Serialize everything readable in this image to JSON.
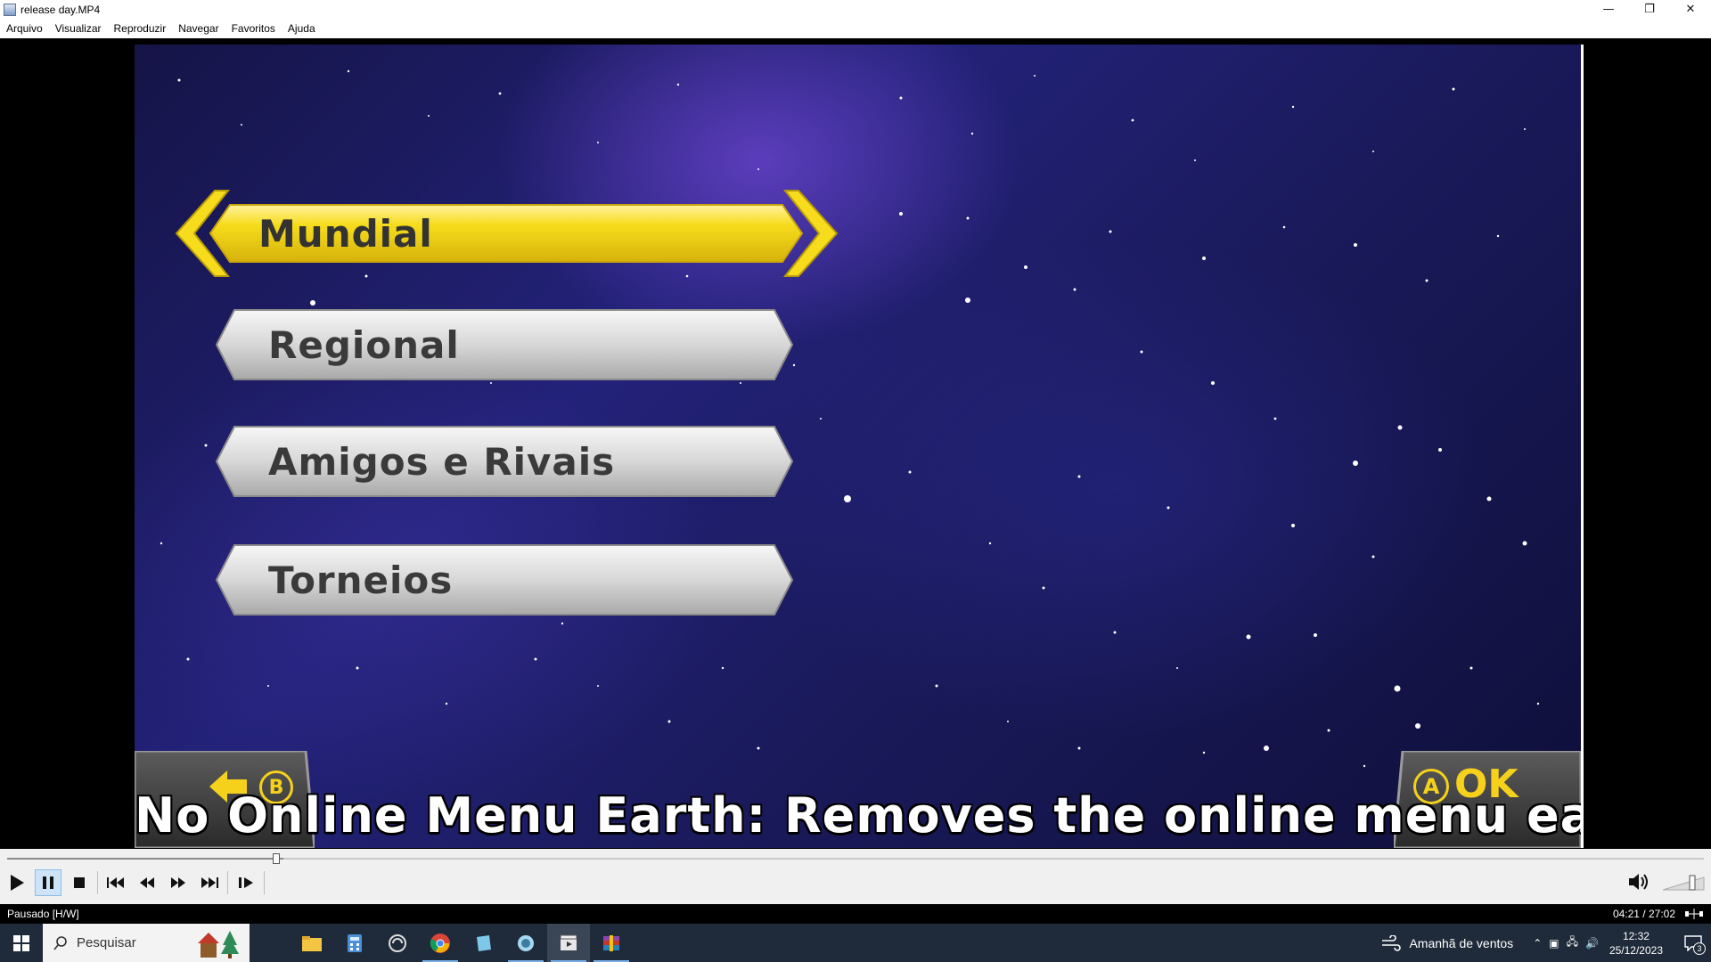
{
  "window": {
    "title": "release day.MP4",
    "controls": {
      "minimize": "—",
      "restore": "❐",
      "close": "✕"
    }
  },
  "menubar": {
    "items": [
      "Arquivo",
      "Visualizar",
      "Reproduzir",
      "Navegar",
      "Favoritos",
      "Ajuda"
    ]
  },
  "video": {
    "menu_options": [
      "Mundial",
      "Regional",
      "Amigos e Rivais",
      "Torneios"
    ],
    "selected_option": "Mundial",
    "back_button_glyph": "B",
    "ok_button_glyph": "A",
    "ok_label": "OK",
    "caption": "No Online Menu Earth: Removes the online menu earth"
  },
  "player": {
    "seek_progress_fraction": 0.163,
    "state": "paused",
    "controls": [
      "play-icon",
      "pause-icon",
      "stop-icon",
      "skip-back-icon",
      "rewind-icon",
      "fast-forward-icon",
      "skip-forward-icon",
      "frame-step-icon"
    ]
  },
  "statusbar": {
    "status": "Pausado [H/W]",
    "time": "04:21 / 27:02"
  },
  "taskbar": {
    "search_placeholder": "Pesquisar",
    "apps": [
      "file-explorer-icon",
      "calculator-icon",
      "sync-icon",
      "chrome-icon",
      "notes-icon",
      "app-icon",
      "media-player-icon",
      "winrar-icon"
    ],
    "weather": "Amanhã de ventos",
    "clock_time": "12:32",
    "clock_date": "25/12/2023",
    "notification_count": "3"
  },
  "colors": {
    "accent_yellow": "#f5d11b",
    "space_blue": "#1a1a5c",
    "taskbar": "#1f2a3a"
  }
}
